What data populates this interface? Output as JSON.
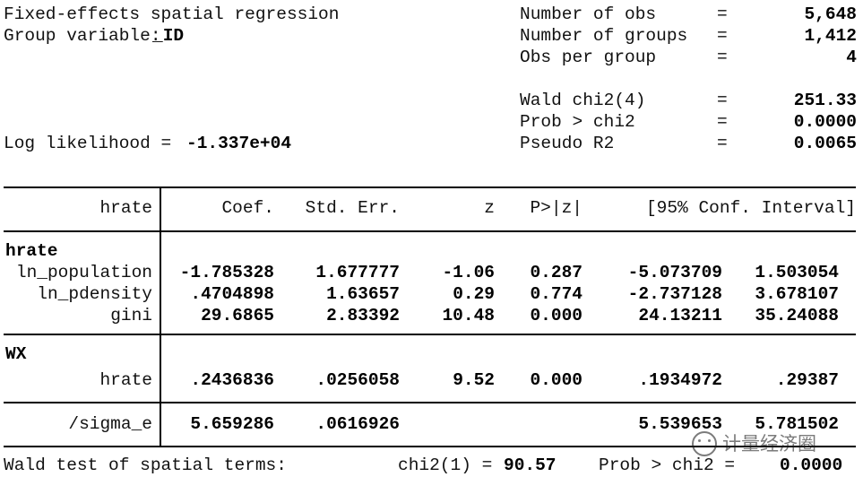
{
  "header": {
    "title": "Fixed-effects spatial regression",
    "group_variable_label": "Group variable:",
    "group_variable_value": "_ID",
    "log_likelihood_label": "Log likelihood =",
    "log_likelihood_value": "-1.337e+04",
    "stats": [
      {
        "label": "Number of obs",
        "eq": "=",
        "value": "5,648"
      },
      {
        "label": "Number of groups",
        "eq": "=",
        "value": "1,412"
      },
      {
        "label": "Obs per group",
        "eq": "=",
        "value": "4"
      },
      {
        "label": "Wald chi2(4)",
        "eq": "=",
        "value": "251.33"
      },
      {
        "label": "Prob > chi2",
        "eq": "=",
        "value": "0.0000"
      },
      {
        "label": "Pseudo R2",
        "eq": "=",
        "value": "0.0065"
      }
    ]
  },
  "table": {
    "columns": {
      "dependent": "hrate",
      "coef": "Coef.",
      "std_err": "Std. Err.",
      "z": "z",
      "p": "P>|z|",
      "ci": "[95% Conf. Interval]"
    },
    "groups": [
      {
        "name": "hrate",
        "rows": [
          {
            "var": "ln_population",
            "coef": "-1.785328",
            "se": "1.677777",
            "z": "-1.06",
            "p": "0.287",
            "ci_low": "-5.073709",
            "ci_high": "1.503054"
          },
          {
            "var": "ln_pdensity",
            "coef": ".4704898",
            "se": "1.63657",
            "z": "0.29",
            "p": "0.774",
            "ci_low": "-2.737128",
            "ci_high": "3.678107"
          },
          {
            "var": "gini",
            "coef": "29.6865",
            "se": "2.83392",
            "z": "10.48",
            "p": "0.000",
            "ci_low": "24.13211",
            "ci_high": "35.24088"
          }
        ]
      },
      {
        "name": "WX",
        "rows": [
          {
            "var": "hrate",
            "coef": ".2436836",
            "se": ".0256058",
            "z": "9.52",
            "p": "0.000",
            "ci_low": ".1934972",
            "ci_high": ".29387"
          }
        ]
      }
    ],
    "ancillary": [
      {
        "var": "/sigma_e",
        "coef": "5.659286",
        "se": ".0616926",
        "z": "",
        "p": "",
        "ci_low": "5.539653",
        "ci_high": "5.781502"
      }
    ]
  },
  "footer": {
    "wald_test_label": "Wald test of spatial terms:",
    "chi2_label": "chi2(1) =",
    "chi2_value": "90.57",
    "prob_label": "Prob > chi2 =",
    "prob_value": "0.0000"
  },
  "watermark": {
    "text": "计量经济圈",
    "icon": "smiley-face-icon"
  },
  "colors": {
    "text": "#111111",
    "bold_text": "#000000",
    "rule": "#000000",
    "background": "#ffffff",
    "watermark": "#2b2b2b"
  }
}
